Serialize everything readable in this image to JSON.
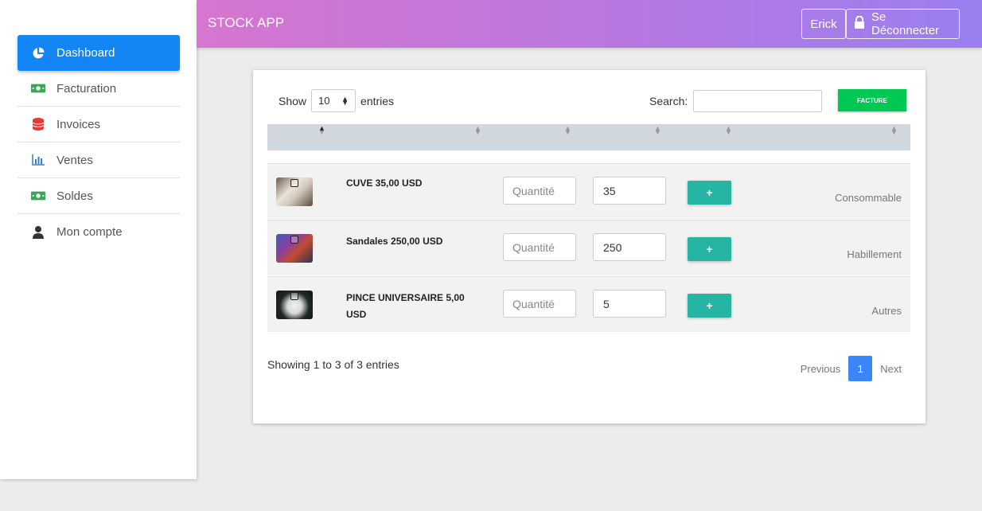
{
  "header": {
    "app_title": "STOCK APP",
    "user_label": "Erick",
    "logout_label": "Se Déconnecter"
  },
  "sidebar": {
    "items": [
      {
        "label": "Dashboard",
        "icon": "pie-chart-icon",
        "active": true
      },
      {
        "label": "Facturation",
        "icon": "money-icon"
      },
      {
        "label": "Invoices",
        "icon": "database-icon"
      },
      {
        "label": "Ventes",
        "icon": "bar-chart-icon"
      },
      {
        "label": "Soldes",
        "icon": "money-icon"
      },
      {
        "label": "Mon compte",
        "icon": "user-icon"
      }
    ]
  },
  "table": {
    "show_label": "Show",
    "entries_label": "entries",
    "page_length": "10",
    "search_label": "Search:",
    "search_value": "",
    "facture_label": "FACTURE",
    "rows": [
      {
        "name": "CUVE 35,00 USD",
        "qty_placeholder": "Quantité",
        "price": "35",
        "add_label": "+",
        "category": "Consommable"
      },
      {
        "name": "Sandales 250,00 USD",
        "qty_placeholder": "Quantité",
        "price": "250",
        "add_label": "+",
        "category": "Habillement"
      },
      {
        "name": "PINCE UNIVERSAIRE 5,00 USD",
        "qty_placeholder": "Quantité",
        "price": "5",
        "add_label": "+",
        "category": "Autres"
      }
    ],
    "info": "Showing 1 to 3 of 3 entries",
    "pagination": {
      "previous": "Previous",
      "current": "1",
      "next": "Next"
    }
  },
  "colors": {
    "sidebar_active": "#1485f5",
    "add_button": "#26b5a3",
    "facture_button": "#00c853",
    "page_active": "#3b86f7"
  }
}
